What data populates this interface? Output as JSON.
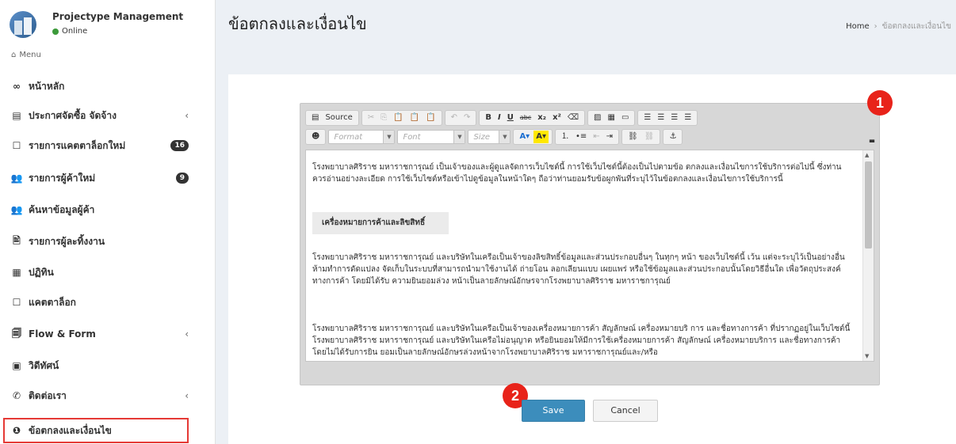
{
  "user": {
    "name": "Projectype Management",
    "status": "Online"
  },
  "menu_header": "Menu",
  "nav": [
    {
      "label": "หน้าหลัก",
      "icon": "infinity-icon",
      "glyph": "∞"
    },
    {
      "label": "ประกาศจัดซื้อ จัดจ้าง",
      "icon": "newspaper-icon",
      "glyph": "▤",
      "chevron": "‹"
    },
    {
      "label": "รายการแคตตาล็อกใหม่",
      "icon": "square-icon",
      "glyph": "☐",
      "badge": "16"
    },
    {
      "label": "รายการผู้ค้าใหม่",
      "icon": "users-icon",
      "glyph": "👥",
      "badge": "9"
    },
    {
      "label": "ค้นหาข้อมูลผู้ค้า",
      "icon": "users-icon",
      "glyph": "👥"
    },
    {
      "label": "รายการผู้ละทิ้งงาน",
      "icon": "file-icon",
      "glyph": "🖹"
    },
    {
      "label": "ปฏิทิน",
      "icon": "calendar-icon",
      "glyph": "▦"
    },
    {
      "label": "แคตตาล็อก",
      "icon": "square-icon",
      "glyph": "☐"
    },
    {
      "label": "Flow & Form",
      "icon": "files-icon",
      "glyph": "🗐",
      "chevron": "‹"
    },
    {
      "label": "วิดีทัศน์",
      "icon": "image-icon",
      "glyph": "▣"
    },
    {
      "label": "ติดต่อเรา",
      "icon": "whatsapp-icon",
      "glyph": "✆",
      "chevron": "‹"
    },
    {
      "label": "ข้อตกลงและเงื่อนไข",
      "icon": "info-icon",
      "glyph": "❶"
    }
  ],
  "page_title": "ข้อตกลงและเงื่อนไข",
  "breadcrumb": {
    "home": "Home",
    "separator": "›",
    "current": "ข้อตกลงและเงื่อนไข"
  },
  "toolbar": {
    "source": "Source",
    "format": "Format",
    "font": "Font",
    "size": "Size"
  },
  "editor": {
    "para1": "โรงพยาบาลศิริราช มหาราชการุณย์ เป็นเจ้าของและผู้ดูแลจัดการเว็บไซต์นี้ การใช้เว็บไซต์นี้ต้องเป็นไปตามข้อ ตกลงและเงื่อนไขการใช้บริการต่อไปนี้ ซึ่งท่านควรอ่านอย่างละเอียด การใช้เว็บไซต์หรือเข้าไปดูข้อมูลในหน้าใดๆ ถือว่าท่านยอมรับข้อผูกพันที่ระบุไว้ในข้อตกลงและเงื่อนไขการใช้บริการนี้",
    "heading": "เครื่องหมายการค้าและลิขสิทธิ์",
    "para2": "โรงพยาบาลศิริราช มหาราชการุณย์ และบริษัทในเครือเป็นเจ้าของลิขสิทธิ์ข้อมูลและส่วนประกอบอื่นๆ ในทุกๆ หน้า ของเว็บไซต์นี้ เว้น แต่จะระบุไว้เป็นอย่างอื่น ห้ามทำการดัดแปลง จัดเก็บในระบบที่สามารถนำมาใช้งานได้ ถ่ายโอน ลอกเลียนแบบ เผยแพร่ หรือใช้ข้อมูลและส่วนประกอบนั้นโดยวิธีอื่นใด เพื่อวัตถุประสงค์ทางการค้า โดยมิได้รับ ความยินยอมล่วง หน้าเป็นลายลักษณ์อักษรจากโรงพยาบาลศิริราช มหาราชการุณย์",
    "para3": "โรงพยาบาลศิริราช มหาราชการุณย์ และบริษัทในเครือเป็นเจ้าของเครื่องหมายการค้า สัญลักษณ์ เครื่องหมายบริ การ และชื่อทางการค้า ที่ปรากฏอยู่ในเว็บไซต์นี้ โรงพยาบาลศิริราช มหาราชการุณย์ และบริษัทในเครือไม่อนุญาต หรือยินยอมให้มีการใช้เครื่องหมายการค้า สัญลักษณ์ เครื่องหมายบริการ และชื่อทางการค้า โดยไม่ได้รับการยิน ยอมเป็นลายลักษณ์อักษรล่วงหน้าจากโรงพยาบาลศิริราช มหาราชการุณย์และ/หรือ"
  },
  "markers": {
    "one": "1",
    "two": "2"
  },
  "buttons": {
    "save": "Save",
    "cancel": "Cancel"
  },
  "colors": {
    "primary": "#3c8dbc",
    "marker": "#e8231a",
    "online": "#3c9a3a"
  }
}
